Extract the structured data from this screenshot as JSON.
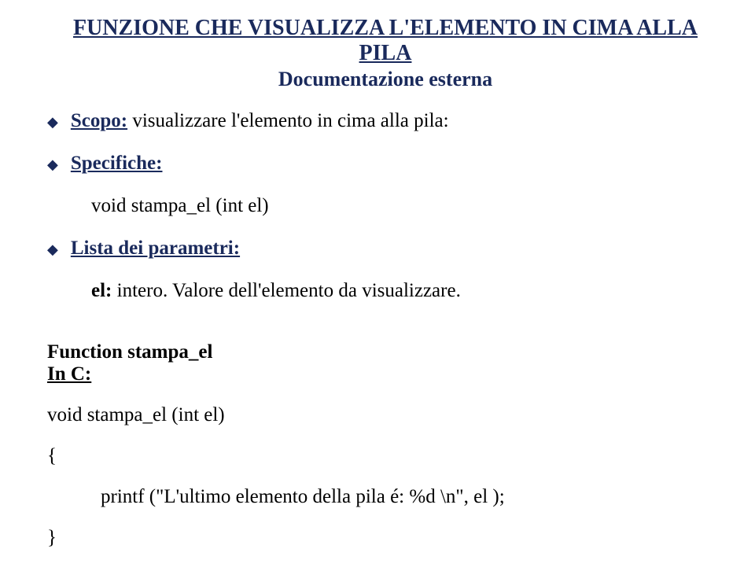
{
  "title": "FUNZIONE CHE VISUALIZZA L'ELEMENTO IN CIMA ALLA PILA",
  "subtitle": "Documentazione esterna",
  "sections": {
    "scopo": {
      "label": "Scopo:",
      "text": " visualizzare l'elemento in cima alla pila:"
    },
    "specifiche": {
      "label": "Specifiche:",
      "body": "void stampa_el (int el)"
    },
    "parametri": {
      "label": "Lista dei parametri:",
      "item_label": "el: ",
      "item_text": "intero. Valore dell'elemento da visualizzare."
    }
  },
  "code": {
    "fn_label": "Function stampa_el",
    "inc_label": "In C:",
    "line1": "void stampa_el (int el)",
    "line2": "{",
    "line3": "printf (\"L'ultimo elemento della pila é: %d \\n\", el );",
    "line4": "}"
  }
}
